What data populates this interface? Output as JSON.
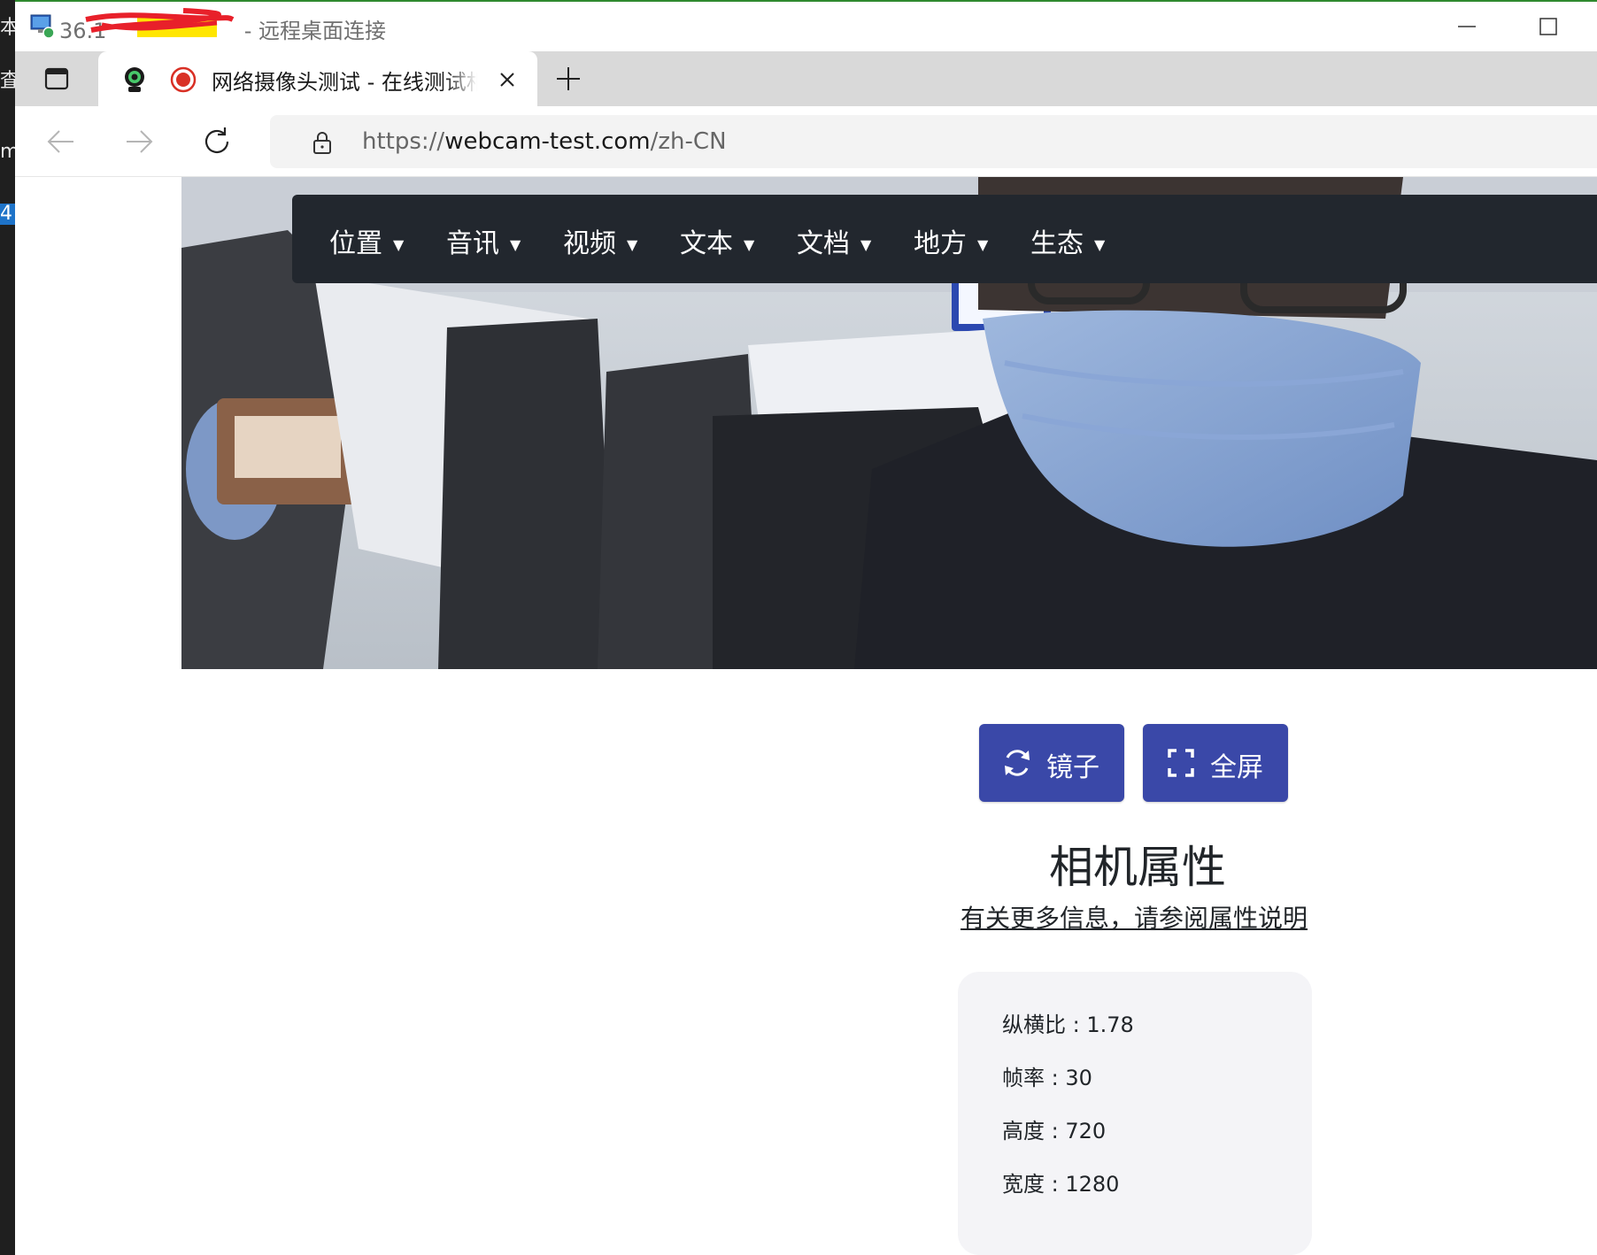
{
  "outer_window": {
    "left_strip_chars": [
      "本",
      "査",
      "m",
      "4"
    ]
  },
  "remote_desktop": {
    "title_prefix": "36.1",
    "title_separator": "-",
    "title_suffix": "远程桌面连接"
  },
  "browser": {
    "tab": {
      "title": "网络摄像头测试 - 在线测试相机"
    },
    "address_bar": {
      "url_scheme": "https://",
      "url_host": "webcam-test.com",
      "url_path": "/zh-CN"
    }
  },
  "site": {
    "menu": [
      {
        "label": "位置"
      },
      {
        "label": "音讯"
      },
      {
        "label": "视频"
      },
      {
        "label": "文本"
      },
      {
        "label": "文档"
      },
      {
        "label": "地方"
      },
      {
        "label": "生态"
      }
    ],
    "buttons": {
      "mirror_label": "镜子",
      "fullscreen_label": "全屏"
    },
    "properties": {
      "heading": "相机属性",
      "more_info_link": "有关更多信息，请参阅属性说明",
      "items": [
        {
          "label": "纵横比",
          "value": "1.78"
        },
        {
          "label": "帧率",
          "value": "30"
        },
        {
          "label": "高度",
          "value": "720"
        },
        {
          "label": "宽度",
          "value": "1280"
        }
      ]
    }
  },
  "colors": {
    "menu_bg": "#22272e",
    "button_bg": "#3a48a8",
    "card_bg": "#f4f4f7",
    "record_red": "#d93025"
  }
}
